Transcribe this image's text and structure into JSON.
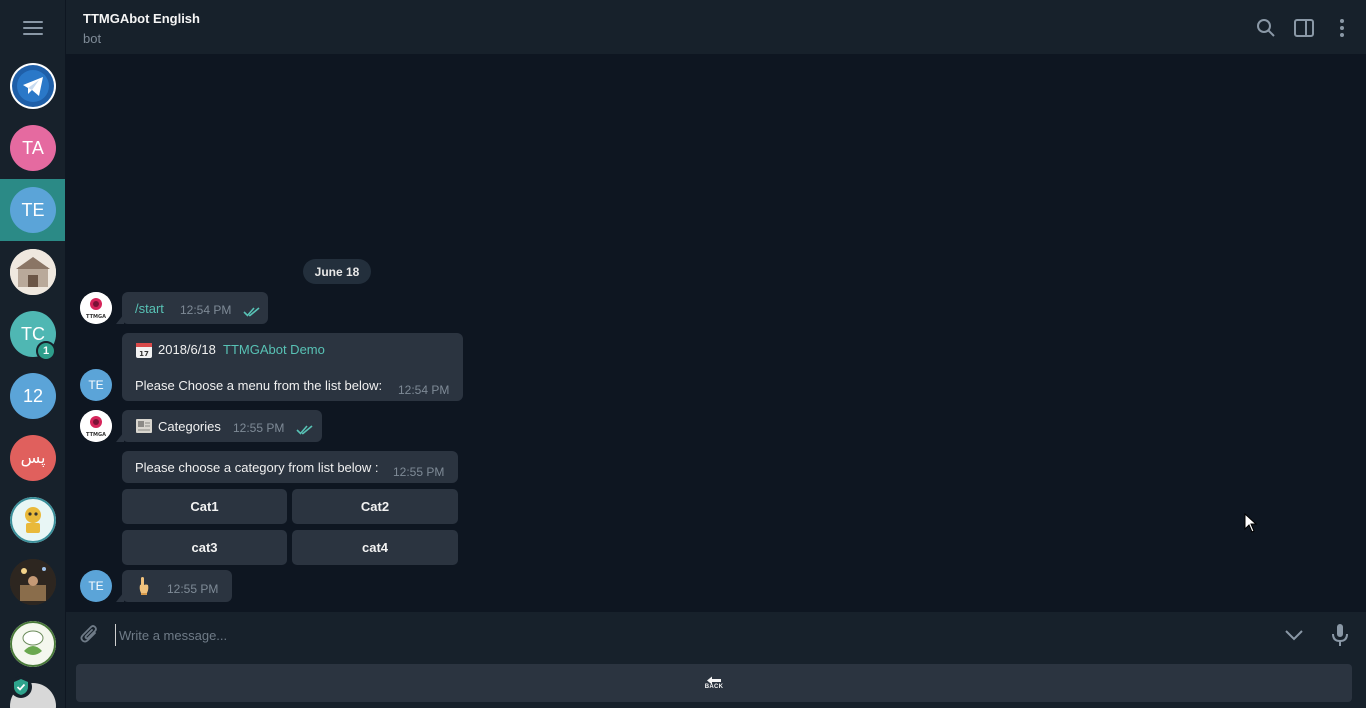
{
  "sidebar": {
    "chats": [
      {
        "initials": "",
        "color": "#ffffff",
        "kind": "telegram-shield"
      },
      {
        "initials": "TA",
        "color": "#e56aa0"
      },
      {
        "initials": "TE",
        "color": "#5ba4d8",
        "active": true
      },
      {
        "initials": "",
        "color": "#c9b9a8",
        "kind": "photo"
      },
      {
        "initials": "TC",
        "color": "#4fb7b3",
        "badge": "1"
      },
      {
        "initials": "12",
        "color": "#5ba4d8"
      },
      {
        "initials": "پس",
        "color": "#e0605d"
      },
      {
        "initials": "",
        "color": "#d8f0ef",
        "kind": "robot"
      },
      {
        "initials": "",
        "color": "#4a3c2c",
        "kind": "photo-dark"
      },
      {
        "initials": "",
        "color": "#ffffff",
        "kind": "chef"
      }
    ]
  },
  "header": {
    "title": "TTMGAbot English",
    "subtitle": "bot"
  },
  "messages": {
    "date": "June 18",
    "m1": {
      "text": "/start",
      "time": "12:54 PM"
    },
    "m2": {
      "date_text": "2018/6/18",
      "link": "TTMGAbot Demo",
      "body": "Please Choose a menu from the list below:",
      "time": "12:54 PM",
      "avatar": "TE"
    },
    "m3": {
      "text": "Categories",
      "time": "12:55 PM"
    },
    "m4": {
      "text": "Please choose a category from list below :",
      "time": "12:55 PM"
    },
    "keyboard": [
      "Cat1",
      "Cat2",
      "cat3",
      "cat4"
    ],
    "m5": {
      "time": "12:55 PM",
      "avatar": "TE"
    }
  },
  "input": {
    "placeholder": "Write a message..."
  },
  "reply_keyboard": {
    "back_label": "BACK"
  }
}
